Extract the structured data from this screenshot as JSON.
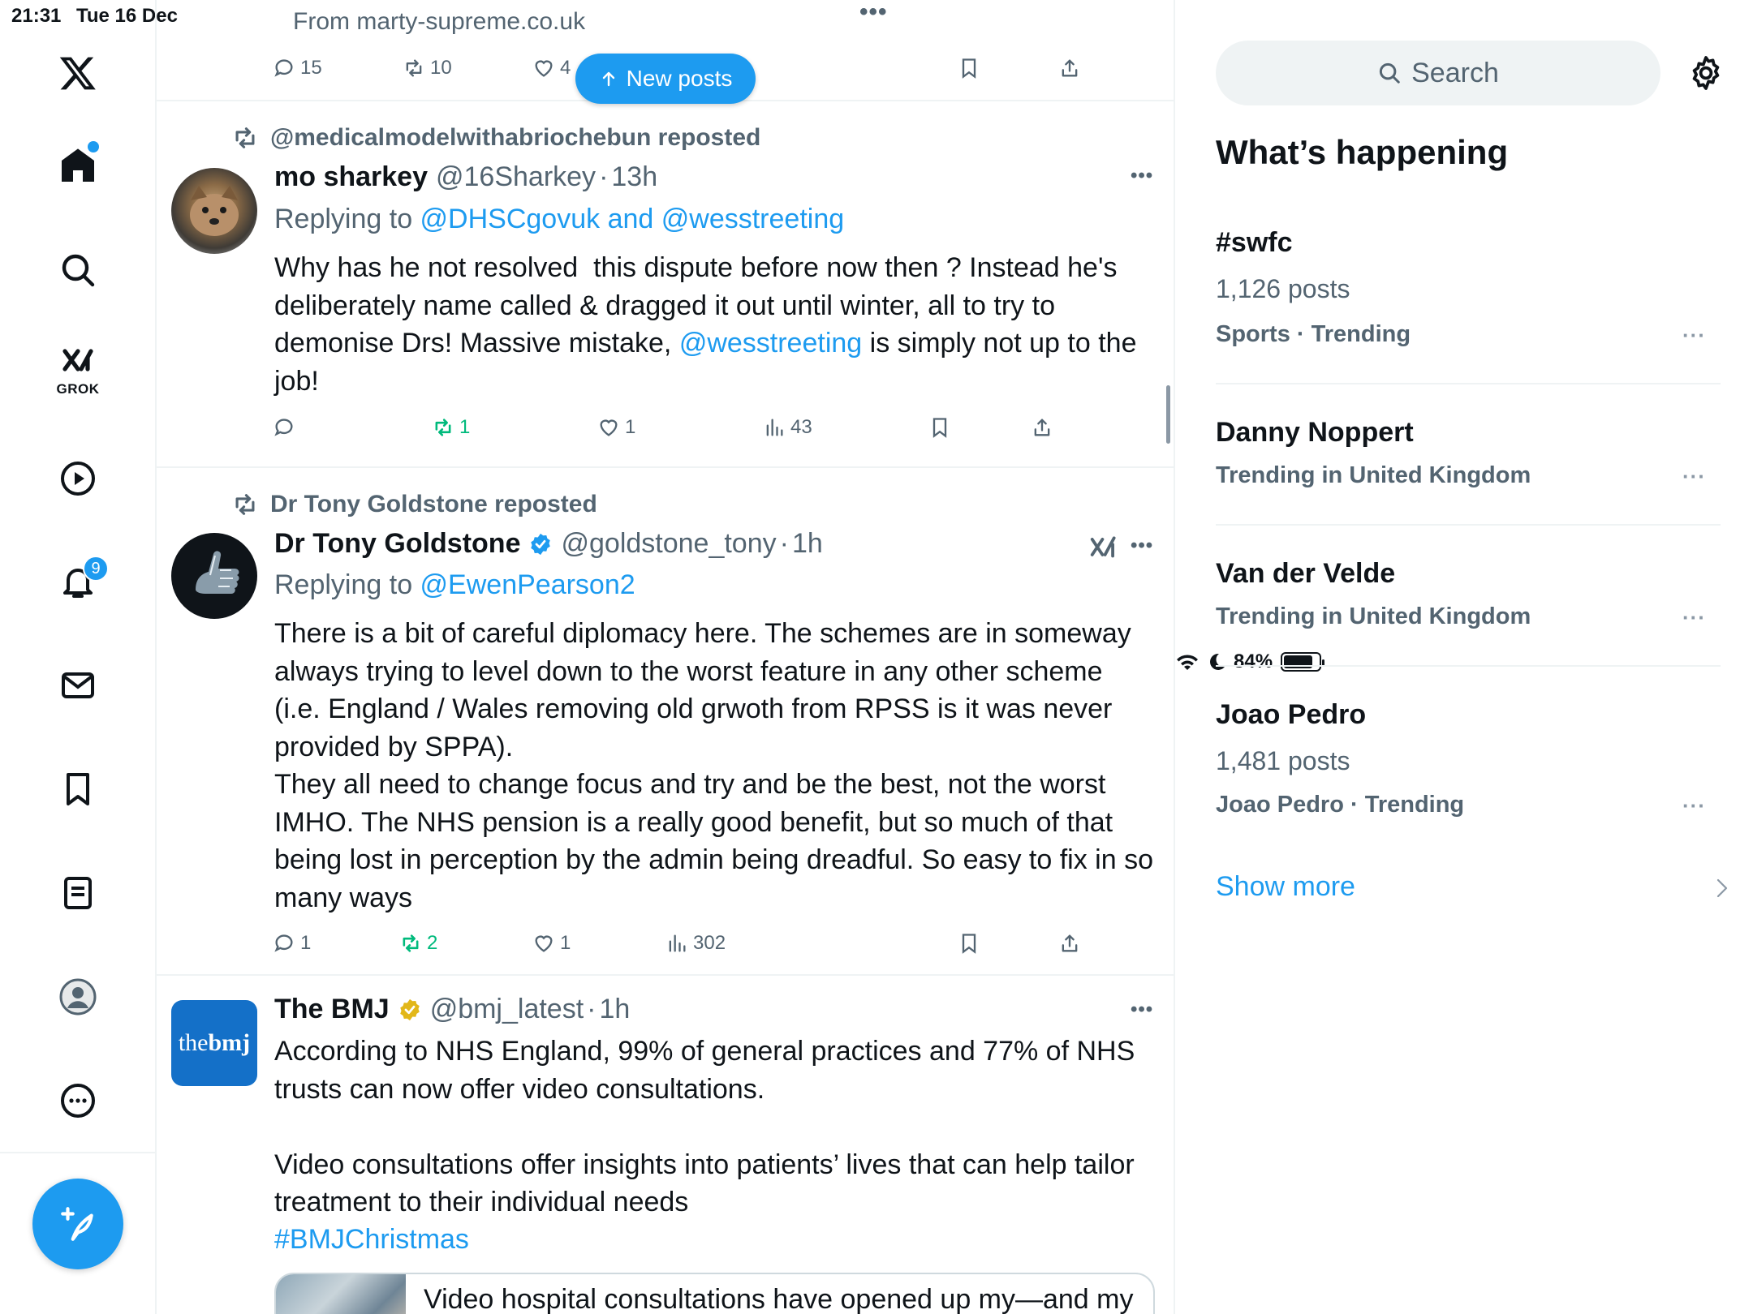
{
  "status_bar": {
    "time": "21:31",
    "date": "Tue 16 Dec",
    "battery": "84%",
    "battery_level": 0.84
  },
  "nav": {
    "items": [
      "home",
      "explore",
      "grok",
      "video",
      "notifications",
      "messages",
      "bookmarks",
      "lists",
      "profile",
      "more"
    ],
    "grok_label": "GROK",
    "notifications_badge": "9"
  },
  "feed": {
    "new_posts_label": "New posts",
    "previous_post": {
      "source": "From marty-supreme.co.uk",
      "replies": "15",
      "reposts": "10",
      "likes": "4"
    },
    "posts": [
      {
        "reposted_by": "@medicalmodelwithabriochebun reposted",
        "name": "mo sharkey",
        "handle": "@16Sharkey",
        "sep": "·",
        "time": "13h",
        "replying_prefix": "Replying to ",
        "replying_to": "@DHSCgovuk and @wesstreeting",
        "text_before": "Why has he not resolved  this dispute before now then ? Instead he's deliberately name called & dragged it out until winter, all to try to demonise Drs! Massive mistake, ",
        "mention": "@wesstreeting",
        "text_after": " is simply not up to the job!",
        "replies": "",
        "reposts": "1",
        "likes": "1",
        "views": "43"
      },
      {
        "reposted_by": "Dr Tony Goldstone reposted",
        "name": "Dr Tony Goldstone",
        "handle": "@goldstone_tony",
        "sep": "·",
        "time": "1h",
        "replying_prefix": "Replying to ",
        "replying_to": "@EwenPearson2",
        "text": "There is a bit of careful diplomacy here. The schemes are in someway always trying to level down to the worst feature in any other scheme (i.e. England / Wales removing old grwoth from RPSS is it was never provided by SPPA).\nThey all need to change focus and try and be the best, not the worst IMHO. The NHS pension is a really good benefit, but so much of that being lost in perception by the admin being dreadful. So easy to fix in so many ways",
        "replies": "1",
        "reposts": "2",
        "likes": "1",
        "views": "302"
      },
      {
        "name": "The BMJ",
        "handle": "@bmj_latest",
        "sep": "·",
        "time": "1h",
        "avatar_text_1": "the",
        "avatar_text_2": "bmj",
        "text": "According to NHS England, 99% of general practices and 77% of NHS trusts can now offer video consultations.\n\nVideo consultations offer insights into patients’ lives that can help tailor treatment to their individual needs",
        "hashtag": "#BMJChristmas",
        "card_title": "Video hospital consultations have opened up my—and my"
      }
    ]
  },
  "right": {
    "search_placeholder": "Search",
    "whats_happening": "What’s happening",
    "trends": [
      {
        "name": "#swfc",
        "count": "1,126 posts",
        "meta": "Sports · Trending"
      },
      {
        "name": "Danny Noppert",
        "count": "",
        "meta": "Trending in United Kingdom"
      },
      {
        "name": "Van der Velde",
        "count": "",
        "meta": "Trending in United Kingdom"
      },
      {
        "name": "Joao Pedro",
        "count": "1,481 posts",
        "meta": "Joao Pedro · Trending"
      }
    ],
    "show_more": "Show more",
    "more_dots": "···"
  },
  "colors": {
    "accent": "#1d9bf0",
    "repost_green": "#00ba7c",
    "muted": "#536471",
    "gold": "#e2b719"
  }
}
